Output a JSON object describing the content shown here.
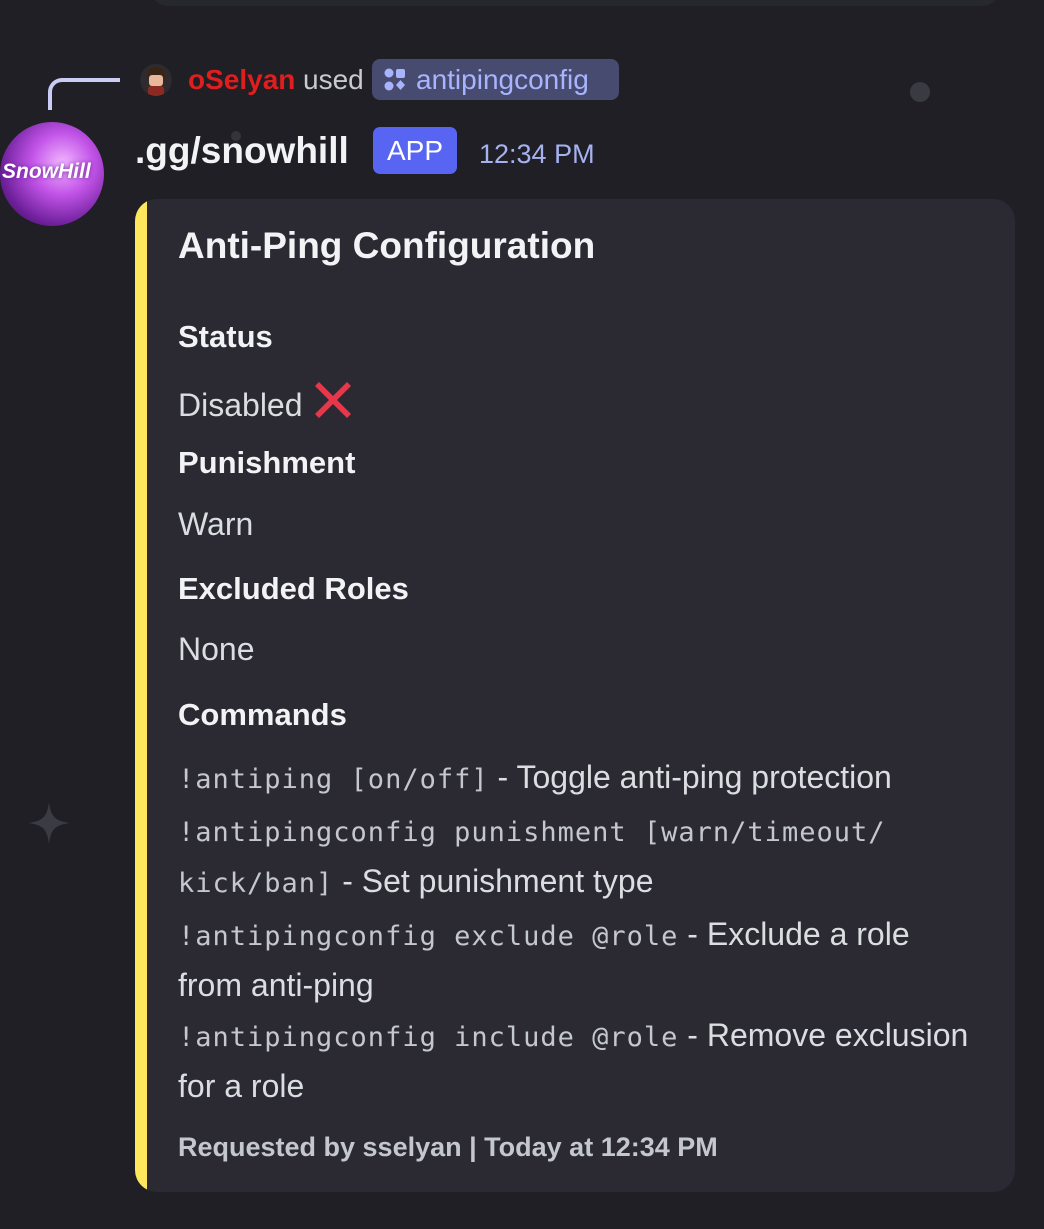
{
  "reply": {
    "username": "oSelyan",
    "used_text": "used",
    "command_name": "antipingconfig",
    "command_icon": "slash-command-icon"
  },
  "message": {
    "author": ".gg/snowhill",
    "avatar_text": "SnowHill",
    "badge": "APP",
    "timestamp": "12:34 PM"
  },
  "embed": {
    "accent_color": "#fee75c",
    "title": "Anti-Ping Configuration",
    "fields": [
      {
        "name": "Status",
        "value": "Disabled",
        "icon": "cross-mark-icon"
      },
      {
        "name": "Punishment",
        "value": "Warn"
      },
      {
        "name": "Excluded Roles",
        "value": "None"
      },
      {
        "name": "Commands"
      }
    ],
    "commands": [
      {
        "code": "!antiping [on/off]",
        "desc": " - Toggle anti-ping protection"
      },
      {
        "code": "!antipingconfig punishment [warn/timeout/ kick/ban]",
        "desc": " - Set punishment type"
      },
      {
        "code": "!antipingconfig exclude @role",
        "desc": " - Exclude a role from anti-ping"
      },
      {
        "code": "!antipingconfig include @role",
        "desc": " - Remove exclusion for a role"
      }
    ],
    "footer": "Requested by sselyan | Today at 12:34 PM"
  },
  "colors": {
    "background": "#1f1f25",
    "embed_bg": "#2b2a33",
    "app_badge": "#5865f2",
    "username_red": "#e01e1e",
    "link_blue": "#a9b4ff"
  }
}
